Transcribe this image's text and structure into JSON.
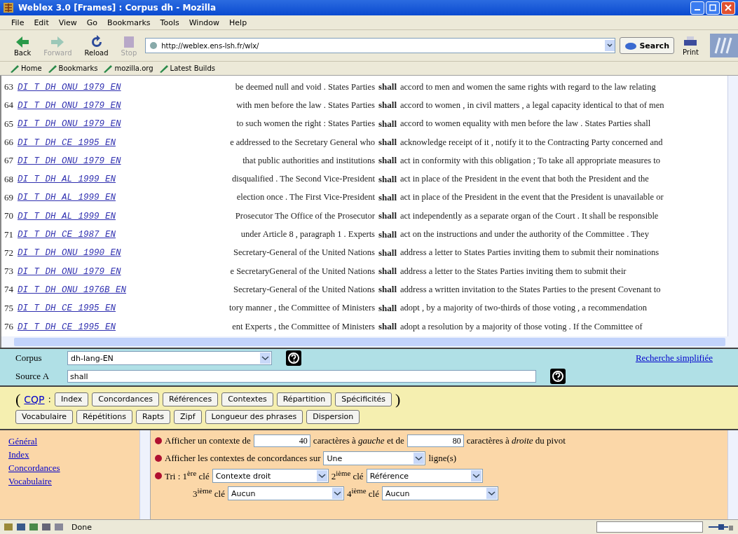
{
  "window": {
    "title": "Weblex 3.0 [Frames] : Corpus dh - Mozilla"
  },
  "menu": [
    "File",
    "Edit",
    "View",
    "Go",
    "Bookmarks",
    "Tools",
    "Window",
    "Help"
  ],
  "nav_buttons": [
    {
      "label": "Back",
      "disabled": false
    },
    {
      "label": "Forward",
      "disabled": true
    },
    {
      "label": "Reload",
      "disabled": false
    },
    {
      "label": "Stop",
      "disabled": true
    }
  ],
  "address": {
    "value": "http://weblex.ens-lsh.fr/wlx/"
  },
  "search_button": "Search",
  "print_button": "Print",
  "bookmarks": [
    "Home",
    "Bookmarks",
    "mozilla.org",
    "Latest Builds"
  ],
  "concordance": [
    {
      "number": "63",
      "reference": "DI T DH ONU 1979 EN",
      "left": "be deemed null and void . States Parties",
      "keyword": "shall",
      "right": "accord to men and women the same rights with regard to the law relating"
    },
    {
      "number": "64",
      "reference": "DI T DH ONU 1979 EN",
      "left": "with men before the law . States Parties",
      "keyword": "shall",
      "right": "accord to women , in civil matters , a legal capacity identical to that of men"
    },
    {
      "number": "65",
      "reference": "DI T DH ONU 1979 EN",
      "left": "to such women the right : States Parties",
      "keyword": "shall",
      "right": "accord to women equality with men before the law . States Parties shall"
    },
    {
      "number": "66",
      "reference": "DI T DH CE 1995 EN",
      "left": "e addressed to the Secretary General who",
      "keyword": "shall",
      "right": "acknowledge receipt of it , notify it to the Contracting Party concerned and"
    },
    {
      "number": "67",
      "reference": "DI T DH ONU 1979 EN",
      "left": "that public authorities and institutions",
      "keyword": "shall",
      "right": "act in conformity with this obligation ; To take all appropriate measures to"
    },
    {
      "number": "68",
      "reference": "DI T DH AL 1999 EN",
      "left": "disqualified . The Second Vice-President",
      "keyword": "shall",
      "right": "act in place of the President in the event that both the President and the"
    },
    {
      "number": "69",
      "reference": "DI T DH AL 1999 EN",
      "left": "election once . The First Vice-President",
      "keyword": "shall",
      "right": "act in place of the President in the event that the President is unavailable or"
    },
    {
      "number": "70",
      "reference": "DI T DH AL 1999 EN",
      "left": "Prosecutor The Office of the Prosecutor",
      "keyword": "shall",
      "right": "act independently as a separate organ of the Court . It shall be responsible"
    },
    {
      "number": "71",
      "reference": "DI T DH CE 1987 EN",
      "left": "under Article 8 , paragraph 1 . Experts",
      "keyword": "shall",
      "right": "act on the instructions and under the authority of the Committee . They"
    },
    {
      "number": "72",
      "reference": "DI T DH ONU 1990 EN",
      "left": "Secretary-General of the United Nations",
      "keyword": "shall",
      "right": "address a letter to States Parties inviting them to submit their nominations"
    },
    {
      "number": "73",
      "reference": "DI T DH ONU 1979 EN",
      "left": "e SecretaryGeneral of the United Nations",
      "keyword": "shall",
      "right": "address a letter to the States Parties inviting them to submit their"
    },
    {
      "number": "74",
      "reference": "DI T DH ONU 1976B EN",
      "left": "Secretary-General of the United Nations",
      "keyword": "shall",
      "right": "address a written invitation to the States Parties to the present Covenant to"
    },
    {
      "number": "75",
      "reference": "DI T DH CE 1995 EN",
      "left": "tory manner , the Committee of Ministers",
      "keyword": "shall",
      "right": "adopt , by a majority of two-thirds of those voting , a recommendation"
    },
    {
      "number": "76",
      "reference": "DI T DH CE 1995 EN",
      "left": "ent Experts , the Committee of Ministers",
      "keyword": "shall",
      "right": "adopt a resolution by a majority of those voting . If the Committee of"
    }
  ],
  "query": {
    "corpus_label": "Corpus",
    "corpus_value": "dh-lang-EN",
    "source_label": "Source A",
    "source_value": "shall",
    "simple_search_link": "Recherche simplifiée"
  },
  "commands": {
    "open": "(",
    "cqp_link": "CQP",
    "colon": ":",
    "close": ")",
    "buttons": [
      "Index",
      "Concordances",
      "Références",
      "Contextes",
      "Répartition",
      "Spécificités"
    ],
    "buttons_row_2": [
      "Vocabulaire",
      "Répétitions",
      "Rapts",
      "Zipf",
      "Longueur des phrases",
      "Dispersion"
    ]
  },
  "sidebar": [
    "Général",
    "Index",
    "Concordances",
    "Vocabulaire"
  ],
  "options": [
    {
      "kind": "context",
      "parts": [
        "Afficher un contexte de",
        "40",
        "caractères à *gauche* et de",
        "80",
        "caractères à *droite* du pivot"
      ]
    },
    {
      "kind": "lines",
      "parts": [
        "Afficher les contextes de concordances sur",
        "Une",
        "ligne(s)"
      ]
    },
    {
      "kind": "sort",
      "parts": [
        "Tri : 1$^{ère}$ clé",
        "Contexte droit",
        "2$^{ième}$ clé",
        "Référence"
      ]
    },
    {
      "kind": "sort2",
      "parts": [
        "3$^{ième}$ clé",
        "Aucun",
        "4$^{ième}$ clé",
        "Aucun"
      ]
    }
  ],
  "status_bar": {
    "text": "Done"
  }
}
